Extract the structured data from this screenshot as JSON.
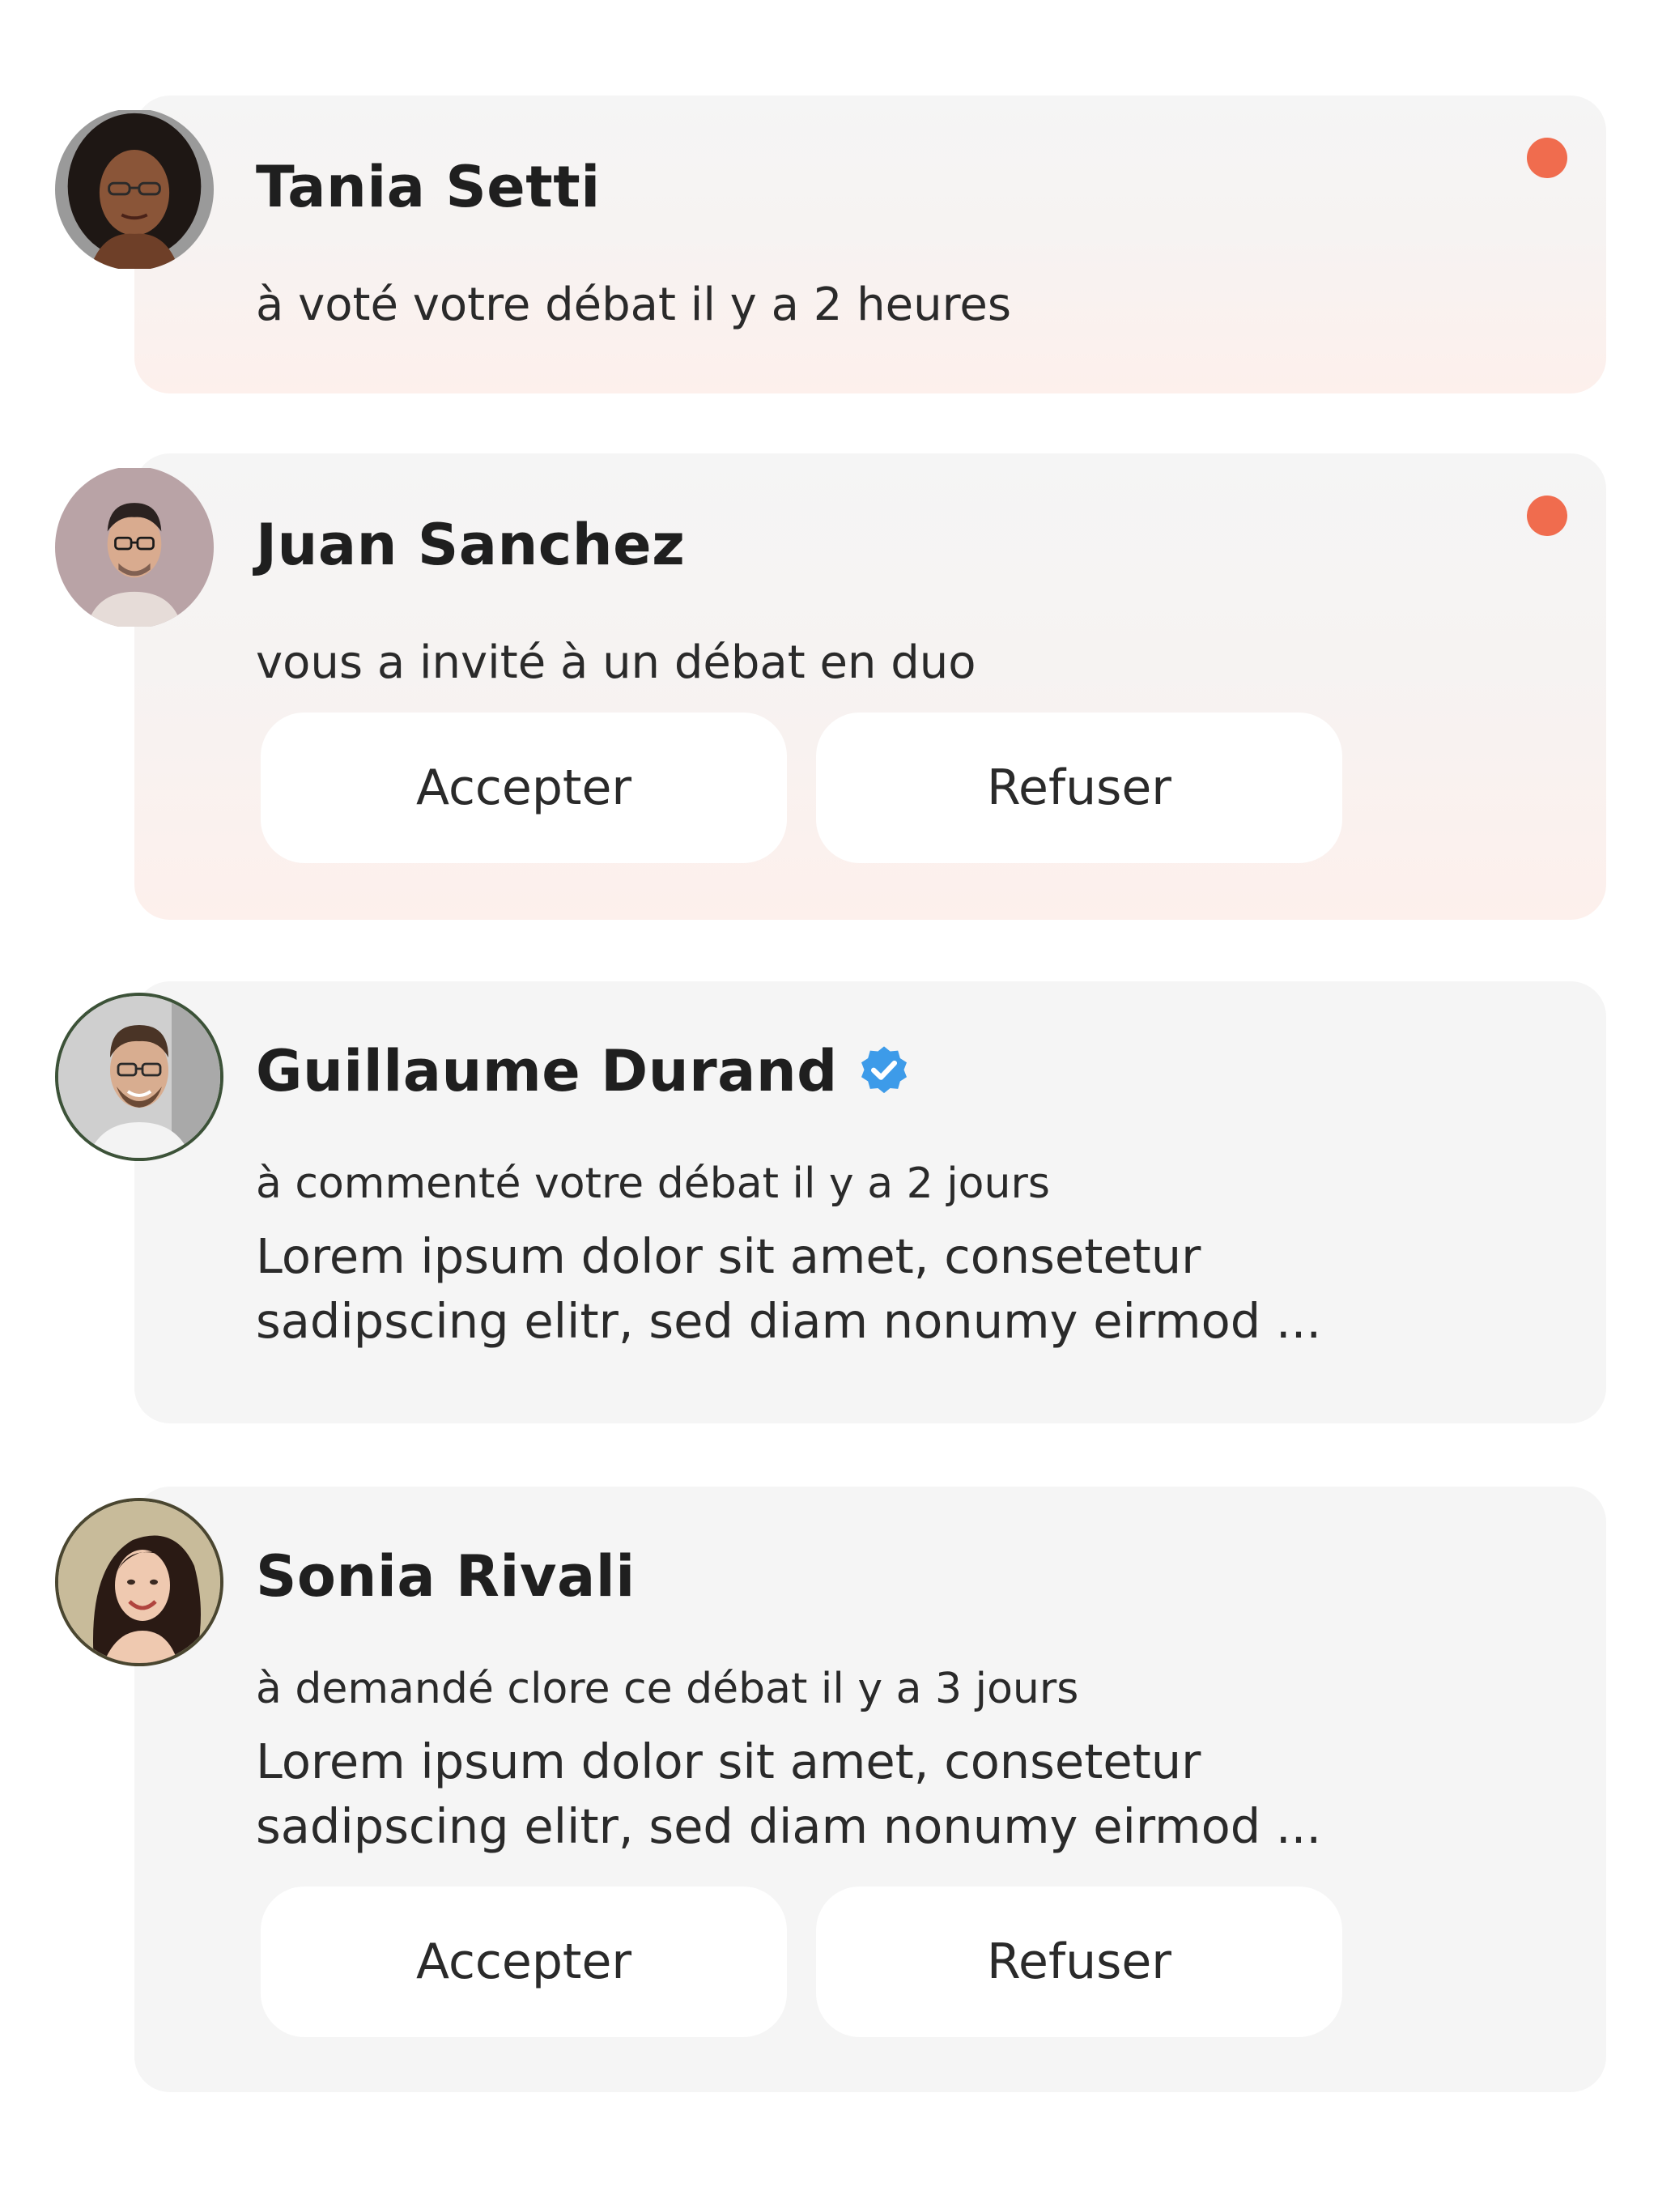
{
  "colors": {
    "unread_dot": "#f06c4e",
    "verified_badge": "#3d9be9",
    "card_background": "#f5f5f5",
    "button_background": "#ffffff"
  },
  "notifications": [
    {
      "name": "Tania Setti",
      "activity": "à voté votre débat il y a 2 heures",
      "unread": true
    },
    {
      "name": "Juan Sanchez",
      "activity": "vous a invité à un débat en duo",
      "unread": true,
      "accept_label": "Accepter",
      "decline_label": "Refuser"
    },
    {
      "name": "Guillaume Durand",
      "verified": true,
      "verified_icon": "verified-badge-icon",
      "activity": "à commenté votre débat il y a 2 jours",
      "excerpt_line1": "Lorem ipsum dolor sit amet, consetetur",
      "excerpt_line2": "sadipscing elitr, sed diam nonumy eirmod ..."
    },
    {
      "name": "Sonia Rivali",
      "activity": "à demandé clore ce débat il y a 3 jours",
      "excerpt_line1": "Lorem ipsum dolor sit amet, consetetur",
      "excerpt_line2": "sadipscing elitr, sed diam nonumy eirmod ...",
      "accept_label": "Accepter",
      "decline_label": "Refuser"
    }
  ]
}
